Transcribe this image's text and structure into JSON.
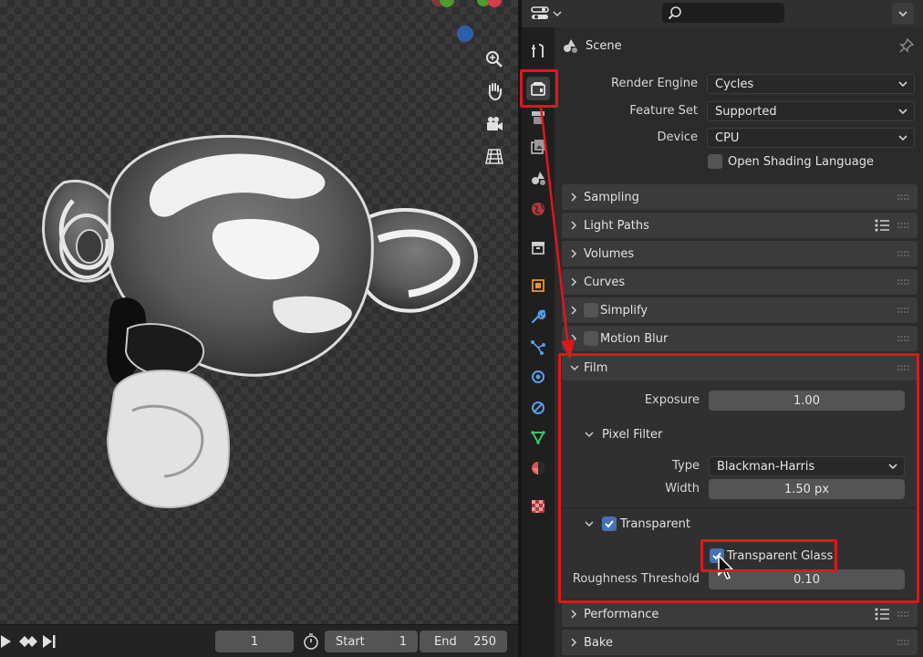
{
  "timeline": {
    "current_frame": "1",
    "start_label": "Start",
    "start_value": "1",
    "end_label": "End",
    "end_value": "250"
  },
  "header": {
    "editor_type_icon": "properties-editor-icon",
    "search_placeholder": ""
  },
  "tabs": [
    {
      "name": "tool",
      "icon": "tool-icon"
    },
    {
      "name": "render",
      "icon": "render-icon",
      "active": true
    },
    {
      "name": "output",
      "icon": "output-icon"
    },
    {
      "name": "view-layer",
      "icon": "view-layer-icon"
    },
    {
      "name": "scene",
      "icon": "scene-icon"
    },
    {
      "name": "world",
      "icon": "world-icon"
    },
    {
      "name": "collection",
      "icon": "collection-icon"
    },
    {
      "name": "object",
      "icon": "object-icon"
    },
    {
      "name": "modifiers",
      "icon": "wrench-icon"
    },
    {
      "name": "particles",
      "icon": "particles-icon"
    },
    {
      "name": "physics",
      "icon": "physics-icon"
    },
    {
      "name": "constraints",
      "icon": "constraints-icon"
    },
    {
      "name": "data",
      "icon": "mesh-data-icon"
    },
    {
      "name": "material",
      "icon": "material-icon"
    },
    {
      "name": "texture",
      "icon": "texture-icon"
    }
  ],
  "context": {
    "label": "Scene"
  },
  "render": {
    "engine_label": "Render Engine",
    "engine_value": "Cycles",
    "feature_set_label": "Feature Set",
    "feature_set_value": "Supported",
    "device_label": "Device",
    "device_value": "CPU",
    "osl_label": "Open Shading Language",
    "osl_checked": false
  },
  "panels": {
    "sampling": "Sampling",
    "light_paths": "Light Paths",
    "volumes": "Volumes",
    "curves": "Curves",
    "simplify": "Simplify",
    "motion_blur": "Motion Blur",
    "film": "Film",
    "performance": "Performance",
    "bake": "Bake"
  },
  "film": {
    "exposure_label": "Exposure",
    "exposure_value": "1.00",
    "pixel_filter_label": "Pixel Filter",
    "type_label": "Type",
    "type_value": "Blackman-Harris",
    "width_label": "Width",
    "width_value": "1.50 px",
    "transparent_label": "Transparent",
    "transparent_checked": true,
    "transparent_glass_label": "Transparent Glass",
    "transparent_glass_checked": true,
    "roughness_label": "Roughness Threshold",
    "roughness_value": "0.10"
  },
  "colors": {
    "accent": "#4772b3",
    "highlight": "#e0161b"
  }
}
